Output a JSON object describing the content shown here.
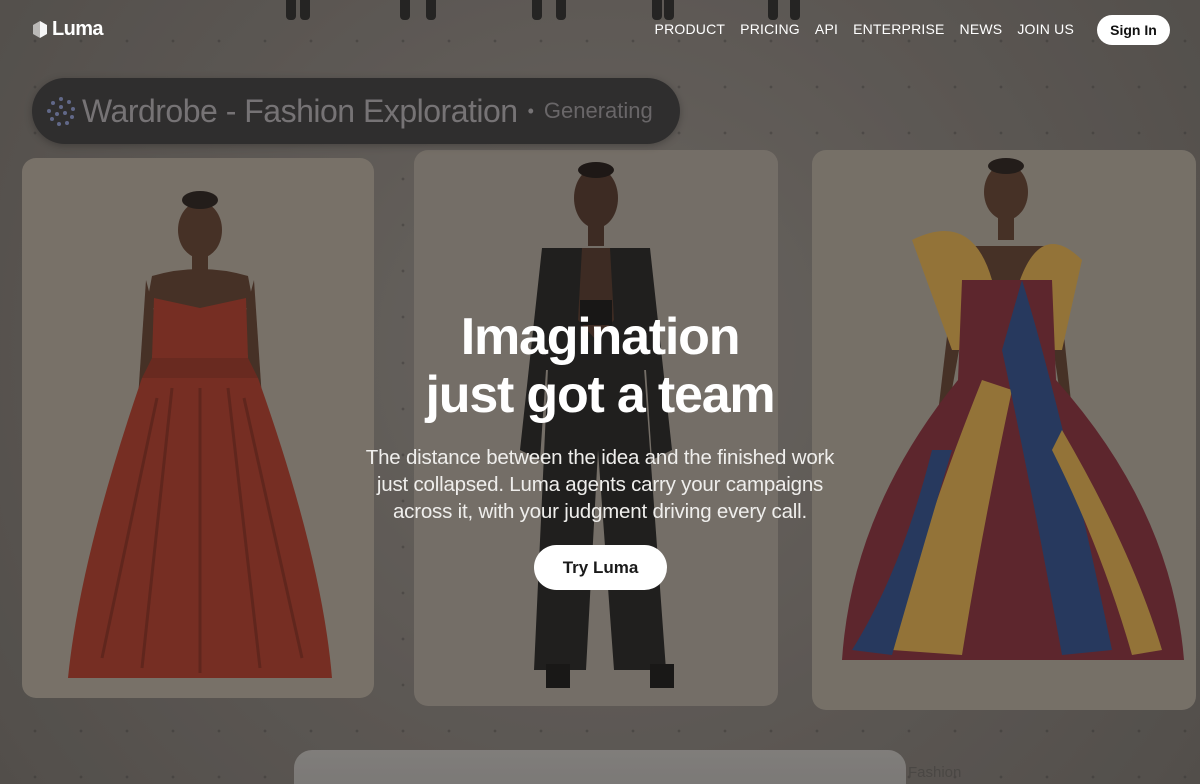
{
  "brand": {
    "name": "Luma"
  },
  "nav": {
    "items": [
      "PRODUCT",
      "PRICING",
      "API",
      "ENTERPRISE",
      "NEWS",
      "JOIN US"
    ],
    "sign_in": "Sign In"
  },
  "canvas": {
    "project_title": "Wardrobe - Fashion Exploration",
    "project_status": "Generating",
    "bottom_label": "Fashion"
  },
  "hero": {
    "headline_line1": "Imagination",
    "headline_line2": "just got a team",
    "body": "The distance between the idea and the finished work just collapsed. Luma agents carry your campaigns across it, with your judgment driving every call.",
    "cta": "Try Luma"
  },
  "colors": {
    "overlay": "#6e6a66",
    "title_pill": "#2a2a2c",
    "red_gown": "#8c2a1c",
    "suit": "#151515",
    "blue_gown": "#1f3a6e",
    "gold_gown": "#b58a3a",
    "wine_gown": "#6a1f2a"
  },
  "icons": [
    "luma-logo-icon",
    "generating-spinner-icon"
  ]
}
